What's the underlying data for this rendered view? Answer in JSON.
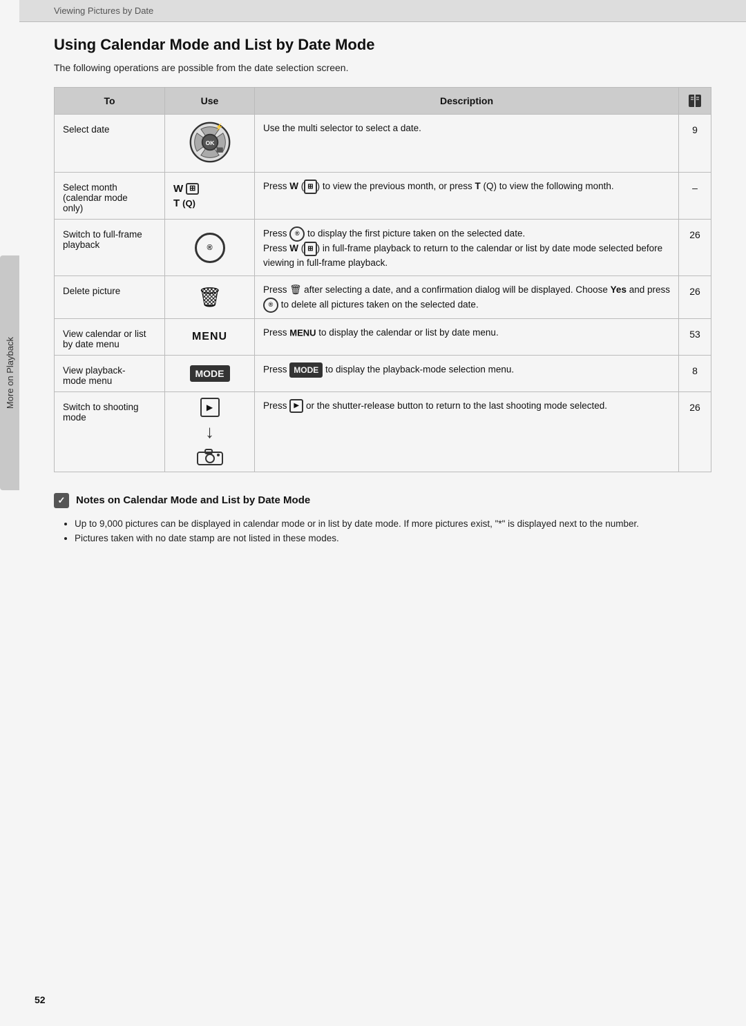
{
  "header": {
    "section": "Viewing Pictures by Date"
  },
  "page": {
    "title": "Using Calendar Mode and List by Date Mode",
    "intro": "The following operations are possible from the date selection screen."
  },
  "table": {
    "columns": {
      "to": "To",
      "use": "Use",
      "description": "Description",
      "page": "page"
    },
    "rows": [
      {
        "to": "Select date",
        "use": "multi_selector",
        "description": "Use the multi selector to select a date.",
        "page": "9"
      },
      {
        "to": "Select month\n(calendar mode\nonly)",
        "use": "wt",
        "description_parts": [
          "Press ",
          "W",
          " (",
          "wide",
          ") to view the previous month, or press ",
          "T",
          " (",
          "tele",
          ") to view the following month."
        ],
        "description": "Press W (⊞) to view the previous month, or press T (Q) to view the following month.",
        "page": "–"
      },
      {
        "to": "Switch to full-frame\nplayback",
        "use": "ok",
        "description": "Press ® to display the first picture taken on the selected date.\nPress W (⊞) in full-frame playback to return to the calendar or list by date mode selected before viewing in full-frame playback.",
        "page": "26"
      },
      {
        "to": "Delete picture",
        "use": "trash",
        "description": "Press 🗑 after selecting a date, and a confirmation dialog will be displayed. Choose Yes and press ® to delete all pictures taken on the selected date.",
        "page": "26"
      },
      {
        "to": "View calendar or list\nby date menu",
        "use": "menu",
        "description": "Press MENU to display the calendar or list by date menu.",
        "page": "53"
      },
      {
        "to": "View playback-\nmode menu",
        "use": "mode",
        "description": "Press MODE to display the playback-mode selection menu.",
        "page": "8"
      },
      {
        "to": "Switch to shooting\nmode",
        "use": "shoot",
        "description": "Press ▶ or the shutter-release button to return to the last shooting mode selected.",
        "page": "26"
      }
    ]
  },
  "notes": {
    "title": "Notes on Calendar Mode and List by Date Mode",
    "items": [
      "Up to 9,000 pictures can be displayed in calendar mode or in list by date mode. If more pictures exist, \"*\" is displayed next to the number.",
      "Pictures taken with no date stamp are not listed in these modes."
    ]
  },
  "side_tab": {
    "label": "More on Playback"
  },
  "page_number": "52"
}
